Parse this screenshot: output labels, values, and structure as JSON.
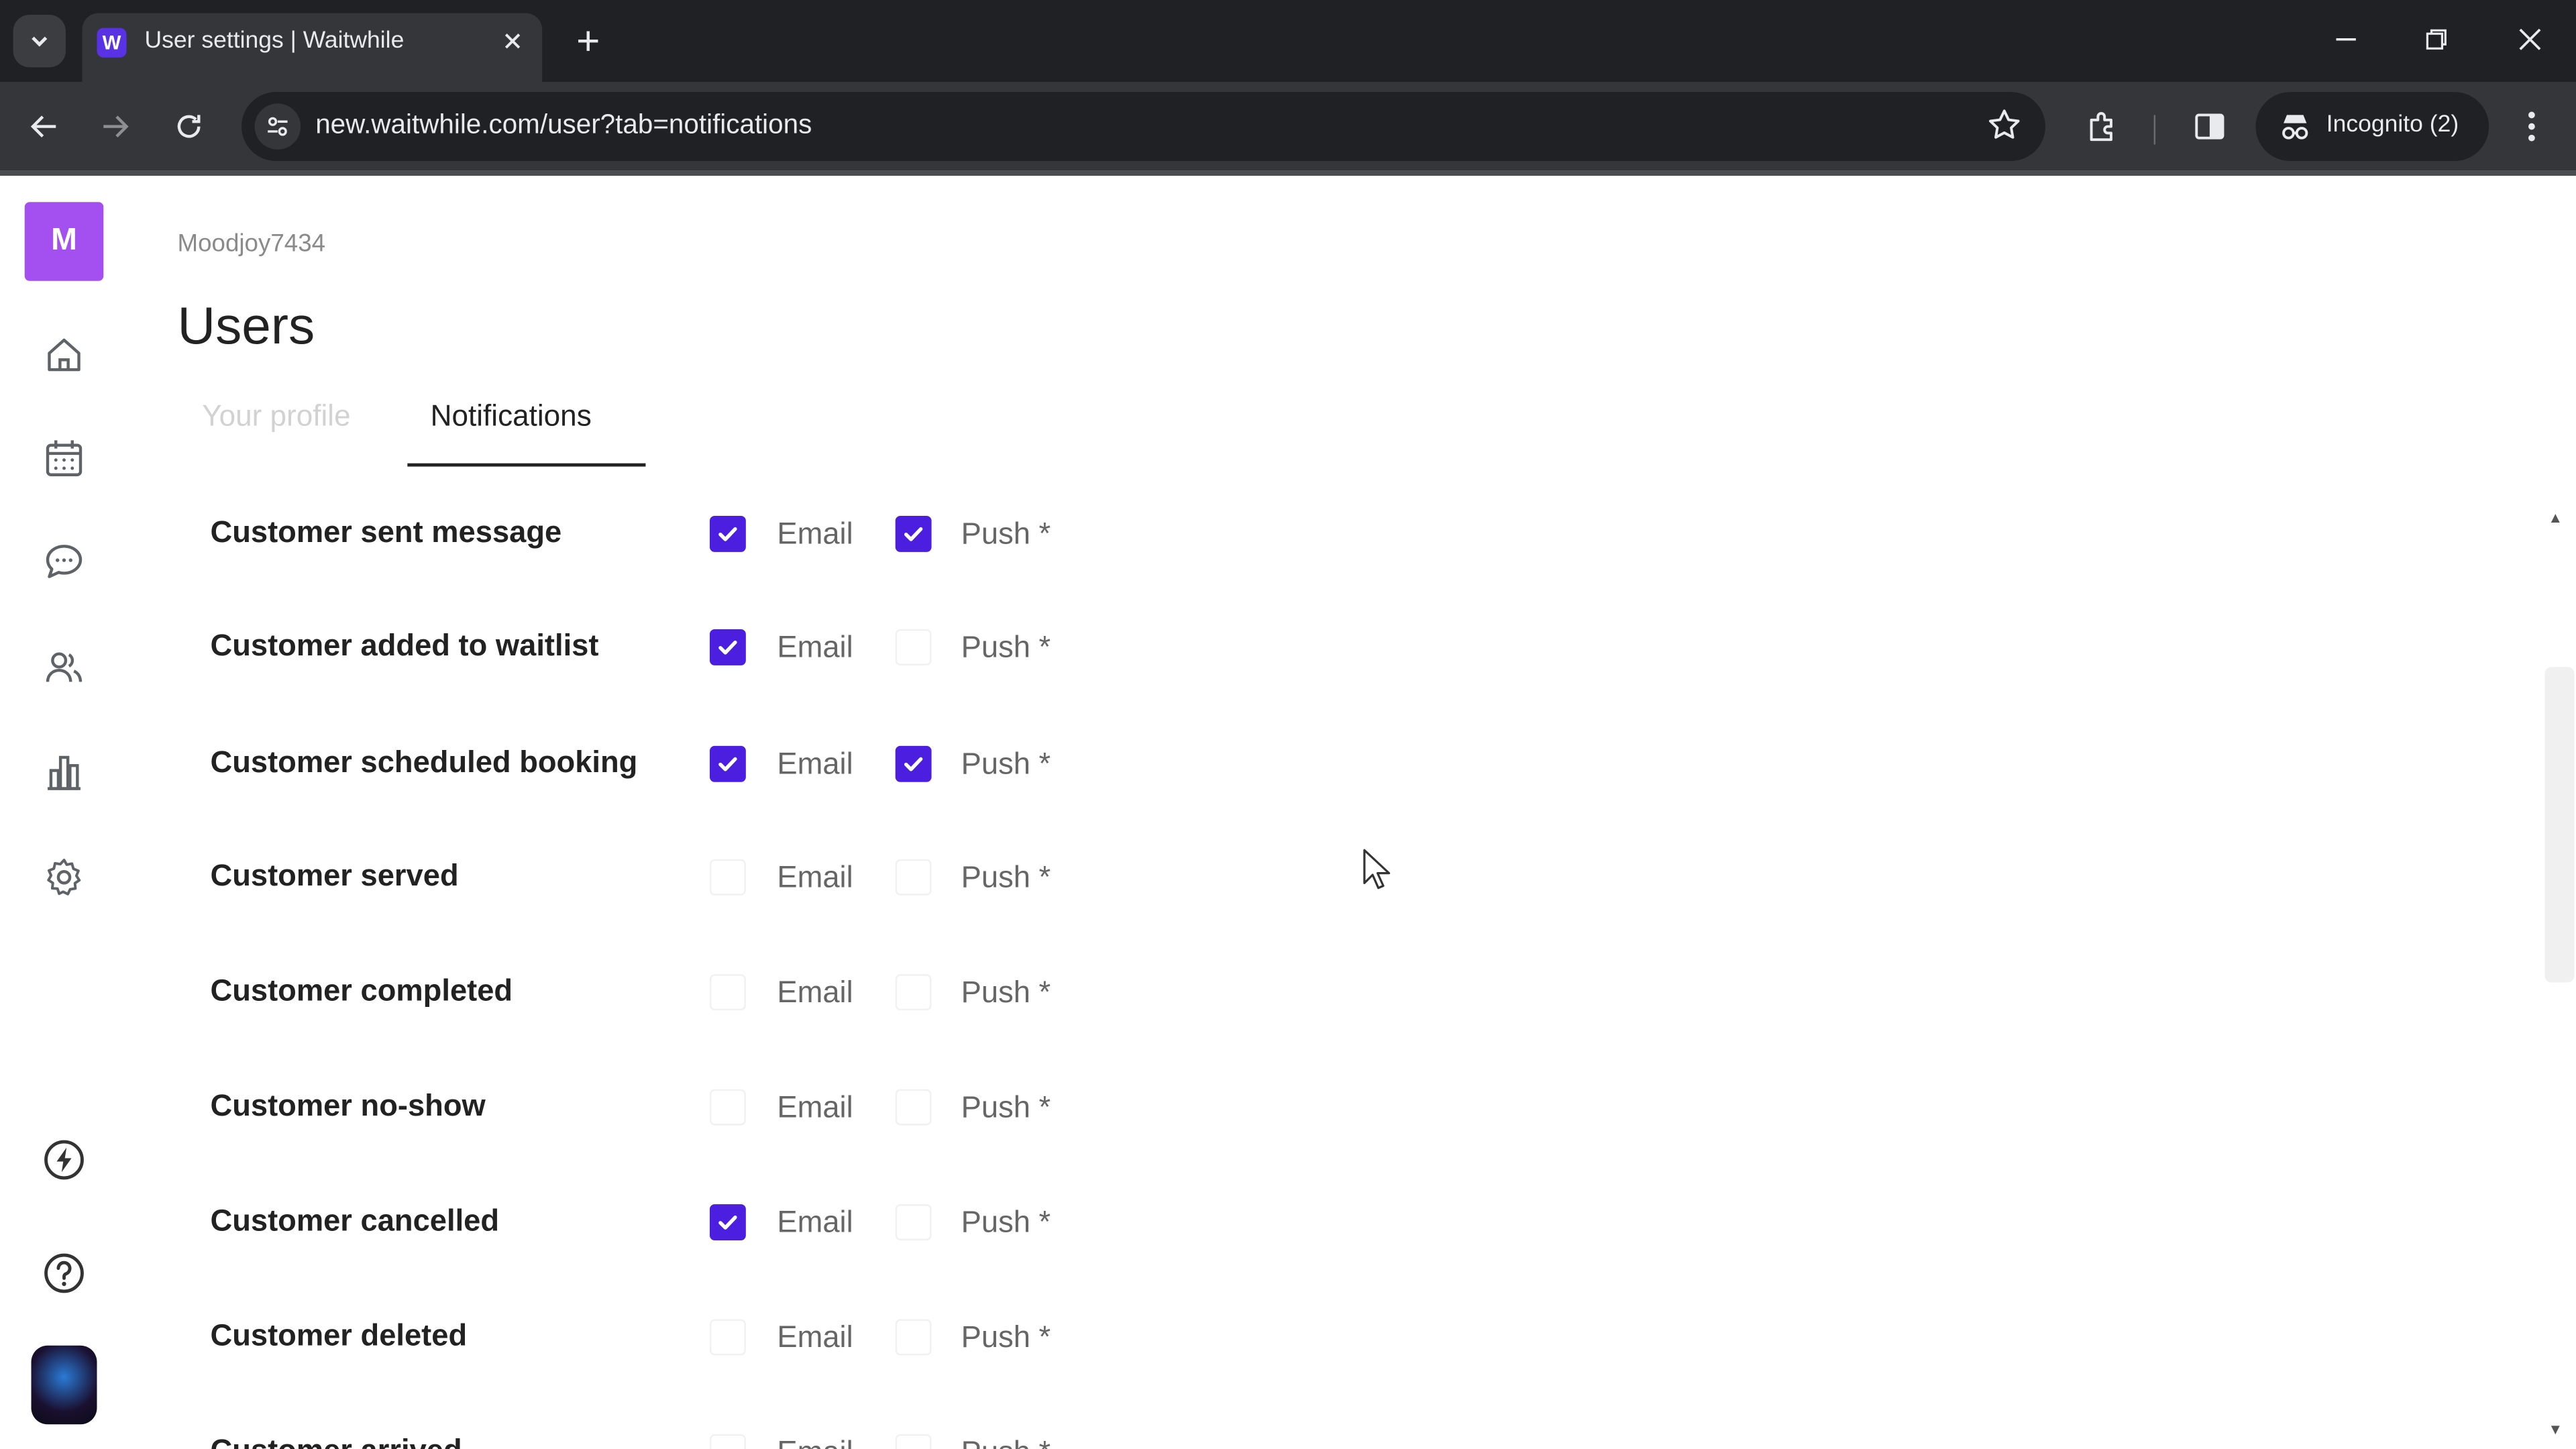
{
  "browser": {
    "tab_title": "User settings | Waitwhile",
    "favicon_letter": "W",
    "url": "new.waitwhile.com/user?tab=notifications",
    "incognito_label": "Incognito (2)"
  },
  "sidebar": {
    "org_initial": "M",
    "icons": [
      "home-icon",
      "calendar-icon",
      "chat-icon",
      "users-icon",
      "analytics-icon",
      "settings-icon",
      "lightning-icon",
      "help-icon"
    ]
  },
  "header": {
    "org_name": "Moodjoy7434",
    "title": "Users",
    "tabs": [
      {
        "label": "Your profile",
        "active": false
      },
      {
        "label": "Notifications",
        "active": true
      }
    ]
  },
  "options": {
    "email": "Email",
    "push": "Push *"
  },
  "notifications": [
    {
      "label": "Customer sent message",
      "email": true,
      "push": true
    },
    {
      "label": "Customer added to waitlist",
      "email": true,
      "push": false
    },
    {
      "label": "Customer scheduled booking",
      "email": true,
      "push": true
    },
    {
      "label": "Customer served",
      "email": false,
      "push": false
    },
    {
      "label": "Customer completed",
      "email": false,
      "push": false
    },
    {
      "label": "Customer no-show",
      "email": false,
      "push": false
    },
    {
      "label": "Customer cancelled",
      "email": true,
      "push": false
    },
    {
      "label": "Customer deleted",
      "email": false,
      "push": false
    },
    {
      "label": "Customer arrived",
      "email": false,
      "push": false
    }
  ],
  "colors": {
    "accent": "#4b1ee0",
    "org_avatar": "#a44ff0"
  }
}
